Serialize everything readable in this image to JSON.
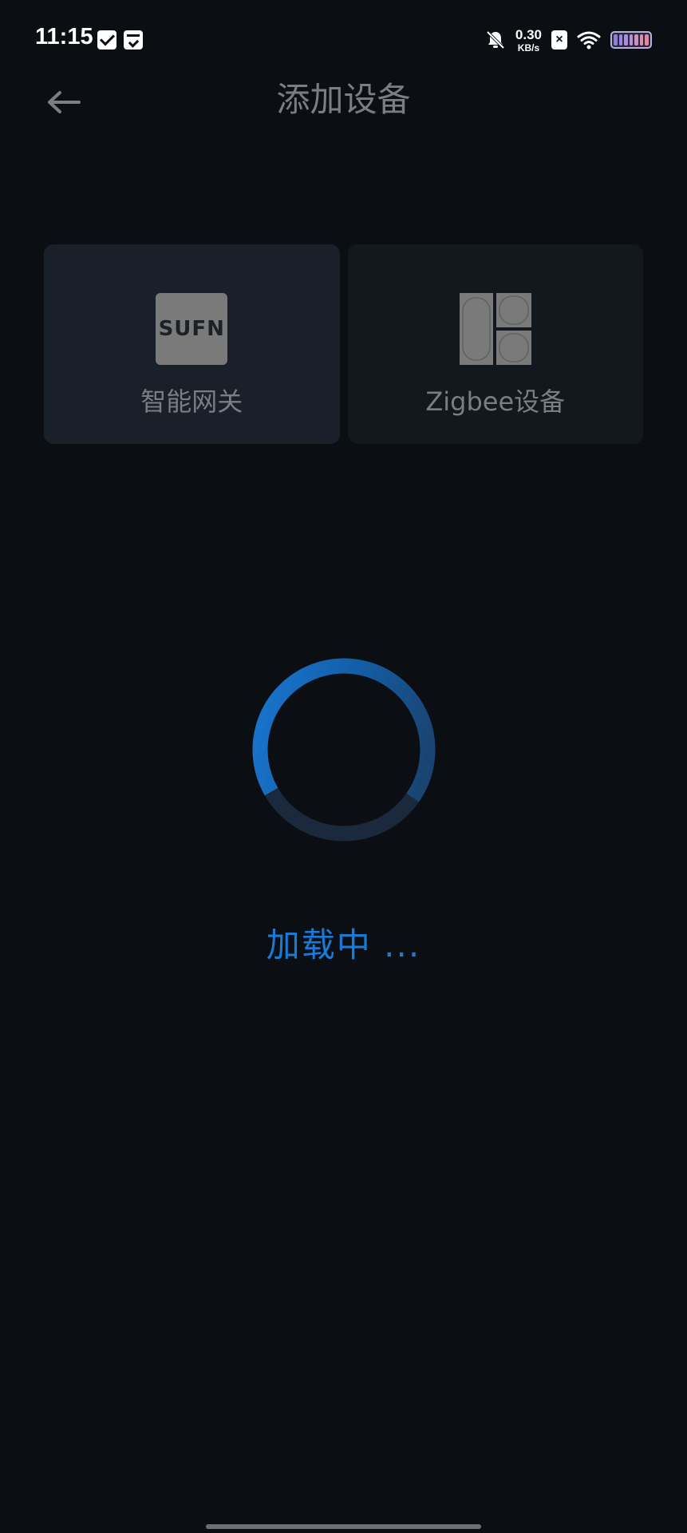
{
  "status_bar": {
    "time": "11:15",
    "net_speed_value": "0.30",
    "net_speed_unit": "KB/s",
    "sim_badge": "×",
    "icons": [
      "mail-icon",
      "inbox-icon",
      "bell-off-icon",
      "sim-x-icon",
      "wifi-icon",
      "battery-icon"
    ]
  },
  "header": {
    "title": "添加设备",
    "back_icon": "arrow-left-icon"
  },
  "devices": [
    {
      "label": "智能网关",
      "logo_text": "SUFN",
      "icon": "gateway-icon"
    },
    {
      "label": "Zigbee设备",
      "icon": "zigbee-switch-icon"
    }
  ],
  "loading": {
    "text": "加载中 ...",
    "progress": 0.35
  },
  "colors": {
    "background": "#0b0e13",
    "accent": "#1a7ad7",
    "muted_text": "#7a7d82",
    "card": "#161c23"
  }
}
